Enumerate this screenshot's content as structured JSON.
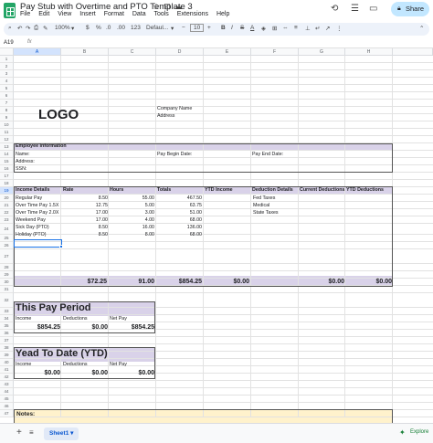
{
  "app": {
    "title": "Pay Stub with Overtime and PTO Template 3",
    "menu": [
      "File",
      "Edit",
      "View",
      "Insert",
      "Format",
      "Data",
      "Tools",
      "Extensions",
      "Help"
    ],
    "share_label": "Share"
  },
  "toolbar": {
    "zoom": "100%",
    "currency": "$",
    "percent": "%",
    "dec_decrease": ".0",
    "dec_increase": ".00",
    "number_format": "123",
    "font": "Defaul...",
    "font_size": "10"
  },
  "formula_bar": {
    "name_box": "A19",
    "fx": "fx",
    "value": ""
  },
  "columns": [
    "A",
    "B",
    "C",
    "D",
    "E",
    "F",
    "G",
    "H"
  ],
  "rows": [
    "1",
    "2",
    "3",
    "4",
    "5",
    "6",
    "7",
    "8",
    "9",
    "10",
    "11",
    "12",
    "13",
    "14",
    "15",
    "16",
    "17",
    "18",
    "19",
    "20",
    "21",
    "22",
    "23",
    "24",
    "25",
    "26",
    "27",
    "28",
    "29",
    "30",
    "31",
    "32",
    "33",
    "34",
    "35",
    "36",
    "37",
    "38",
    "39",
    "40",
    "41",
    "42",
    "43",
    "44",
    "45",
    "46",
    "47"
  ],
  "sheet": {
    "logo": "LOGO",
    "company_name": "Company Name",
    "address": "Address",
    "employee_info": "Employee Information",
    "name_label": "Name:",
    "address_label": "Address:",
    "ssn_label": "SSN:",
    "pay_begin": "Pay Begin Date:",
    "pay_end": "Pay End Date:",
    "headers": [
      "Income Details",
      "Rate",
      "Hours",
      "Totals",
      "YTD Income",
      "Deduction Details",
      "Current Deductions",
      "YTD Deductions"
    ],
    "income_rows": [
      {
        "label": "Regular Pay",
        "rate": "8.50",
        "hours": "55.00",
        "total": "467.50"
      },
      {
        "label": "Over Time Pay 1.5X",
        "rate": "12.75",
        "hours": "5.00",
        "total": "63.75"
      },
      {
        "label": "Over Time Pay 2.0X",
        "rate": "17.00",
        "hours": "3.00",
        "total": "51.00"
      },
      {
        "label": "Weekend Pay",
        "rate": "17.00",
        "hours": "4.00",
        "total": "68.00"
      },
      {
        "label": "Sick Day (PTO)",
        "rate": "8.50",
        "hours": "16.00",
        "total": "136.00"
      },
      {
        "label": "Holiday (PTO)",
        "rate": "8.50",
        "hours": "8.00",
        "total": "68.00"
      }
    ],
    "deductions": [
      "Fed Taxes",
      "Medical",
      "State Taxes"
    ],
    "totals": {
      "rate": "$72.25",
      "hours": "91.00",
      "total": "$854.25",
      "ytd_income": "$0.00",
      "current_ded": "$0.00",
      "ytd_ded": "$0.00"
    },
    "this_period": {
      "title": "This Pay Period",
      "income_label": "Income",
      "deductions_label": "Deductions",
      "net_label": "Net Pay",
      "income": "$854.25",
      "deductions": "$0.00",
      "net": "$854.25"
    },
    "ytd": {
      "title": "Yead To Date (YTD)",
      "income_label": "Income",
      "deductions_label": "Deductions",
      "net_label": "Net Pay",
      "income": "$0.00",
      "deductions": "$0.00",
      "net": "$0.00"
    },
    "notes": "Notes:"
  },
  "bottom": {
    "sheet_tab": "Sheet1",
    "explore": "Explore"
  },
  "colors": {
    "band": "#d9d2e9",
    "notes": "#fff2cc",
    "share": "#c2e7ff",
    "selection": "#1a73e8"
  }
}
